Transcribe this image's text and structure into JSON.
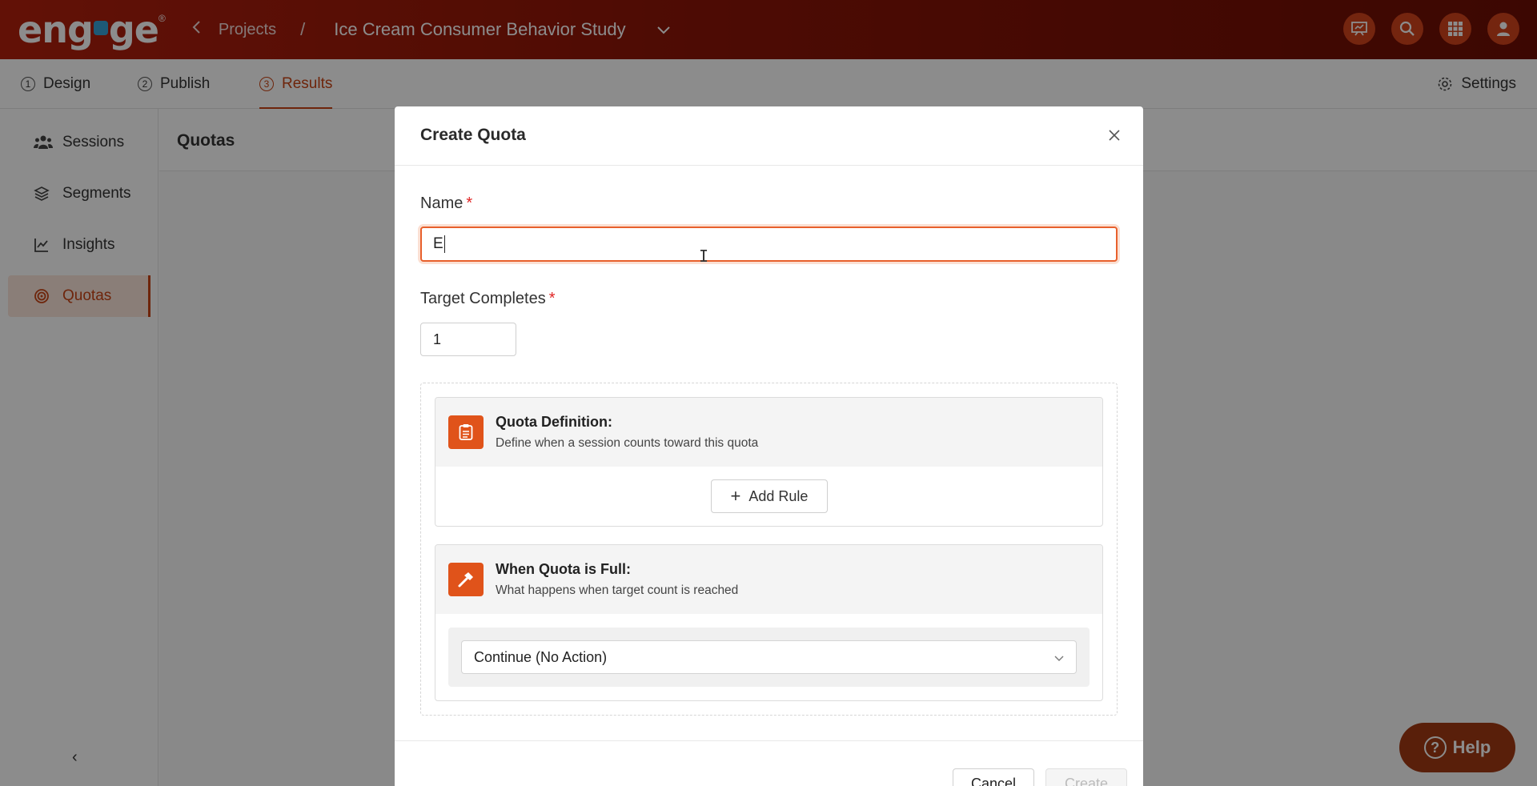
{
  "brand": {
    "logo_text_left": "eng",
    "logo_text_right": "ge",
    "logo_reg": "®"
  },
  "breadcrumb": {
    "back_icon": "chevron-left-icon",
    "projects": "Projects",
    "separator": "/",
    "project_title": "Ice Cream Consumer Behavior Study"
  },
  "top_icons": [
    "presentation-icon",
    "search-icon",
    "apps-grid-icon",
    "user-icon"
  ],
  "tabs": [
    {
      "num": "1",
      "label": "Design"
    },
    {
      "num": "2",
      "label": "Publish"
    },
    {
      "num": "3",
      "label": "Results"
    }
  ],
  "settings_label": "Settings",
  "sidebar": {
    "items": [
      {
        "label": "Sessions",
        "icon": "users-icon"
      },
      {
        "label": "Segments",
        "icon": "layers-icon"
      },
      {
        "label": "Insights",
        "icon": "chart-icon"
      },
      {
        "label": "Quotas",
        "icon": "target-icon"
      }
    ],
    "collapse": "‹"
  },
  "page_title": "Quotas",
  "modal": {
    "title": "Create Quota",
    "name_label": "Name",
    "required_mark": "*",
    "name_value": "E",
    "target_label": "Target Completes",
    "target_value": "1",
    "definition": {
      "title": "Quota Definition:",
      "subtitle": "Define when a session counts toward this quota",
      "add_rule": "Add Rule"
    },
    "when_full": {
      "title": "When Quota is Full:",
      "subtitle": "What happens when target count is reached",
      "selected_action": "Continue (No Action)"
    },
    "cancel": "Cancel",
    "create": "Create"
  },
  "help_label": "Help",
  "colors": {
    "accent": "#c94414",
    "topbar_start": "#b3200c",
    "topbar_end": "#6e0e04",
    "icon_bg": "#e0531a"
  }
}
